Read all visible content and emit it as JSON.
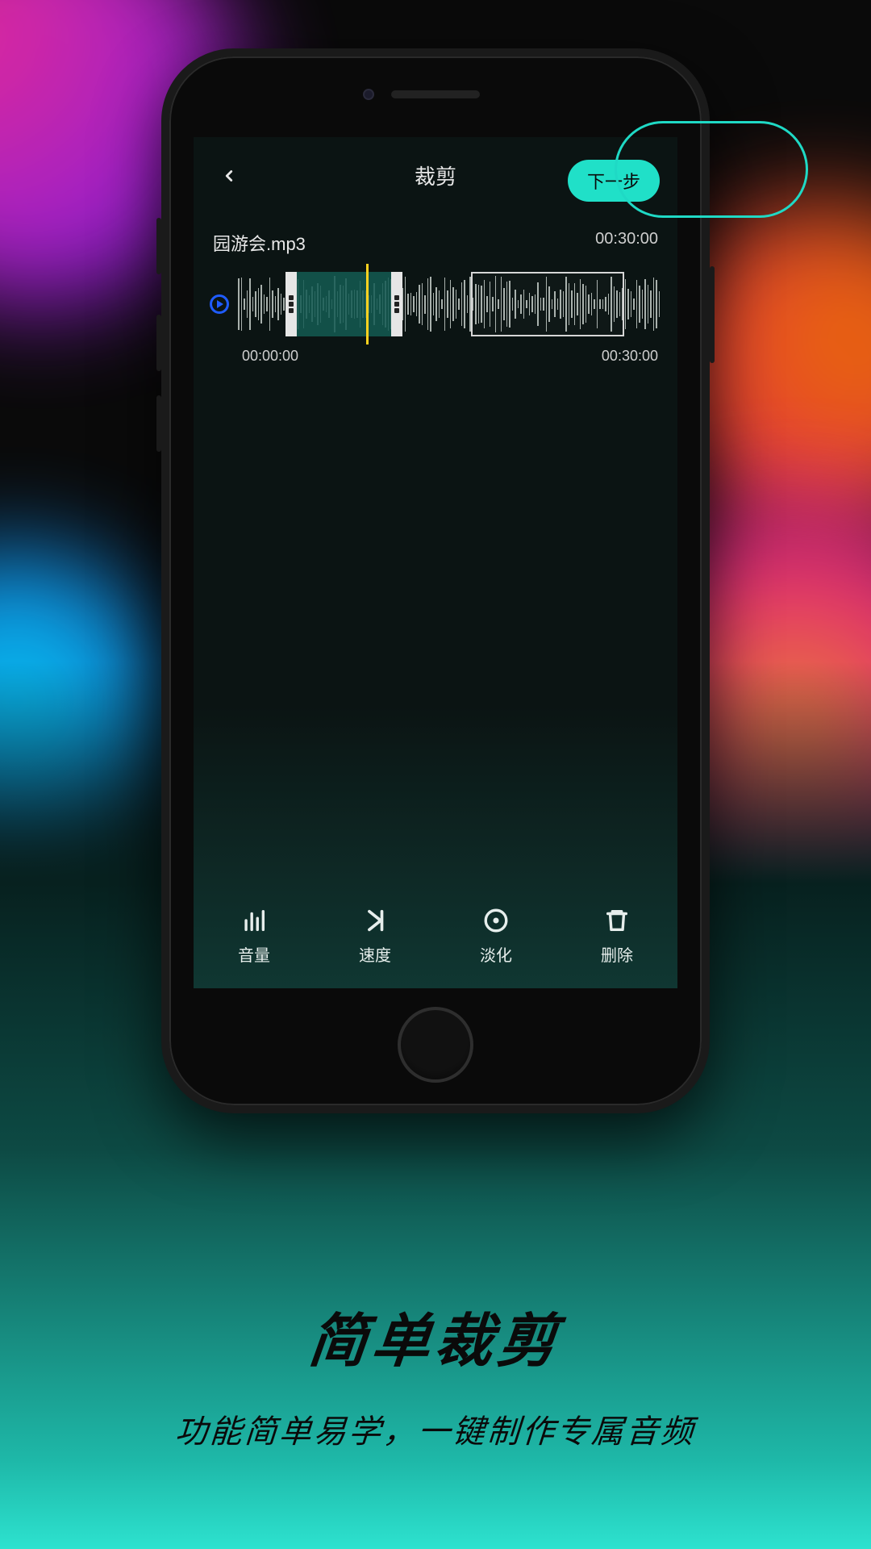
{
  "header": {
    "title": "裁剪",
    "next_label": "下一步"
  },
  "track": {
    "filename": "园游会.mp3",
    "total_duration": "00:30:00",
    "start_time": "00:00:00",
    "end_time": "00:30:00"
  },
  "toolbar": {
    "volume": "音量",
    "speed": "速度",
    "fade": "淡化",
    "delete": "删除"
  },
  "promo": {
    "title": "简单裁剪",
    "subtitle": "功能简单易学，一键制作专属音频"
  },
  "colors": {
    "accent": "#20e0c8"
  }
}
